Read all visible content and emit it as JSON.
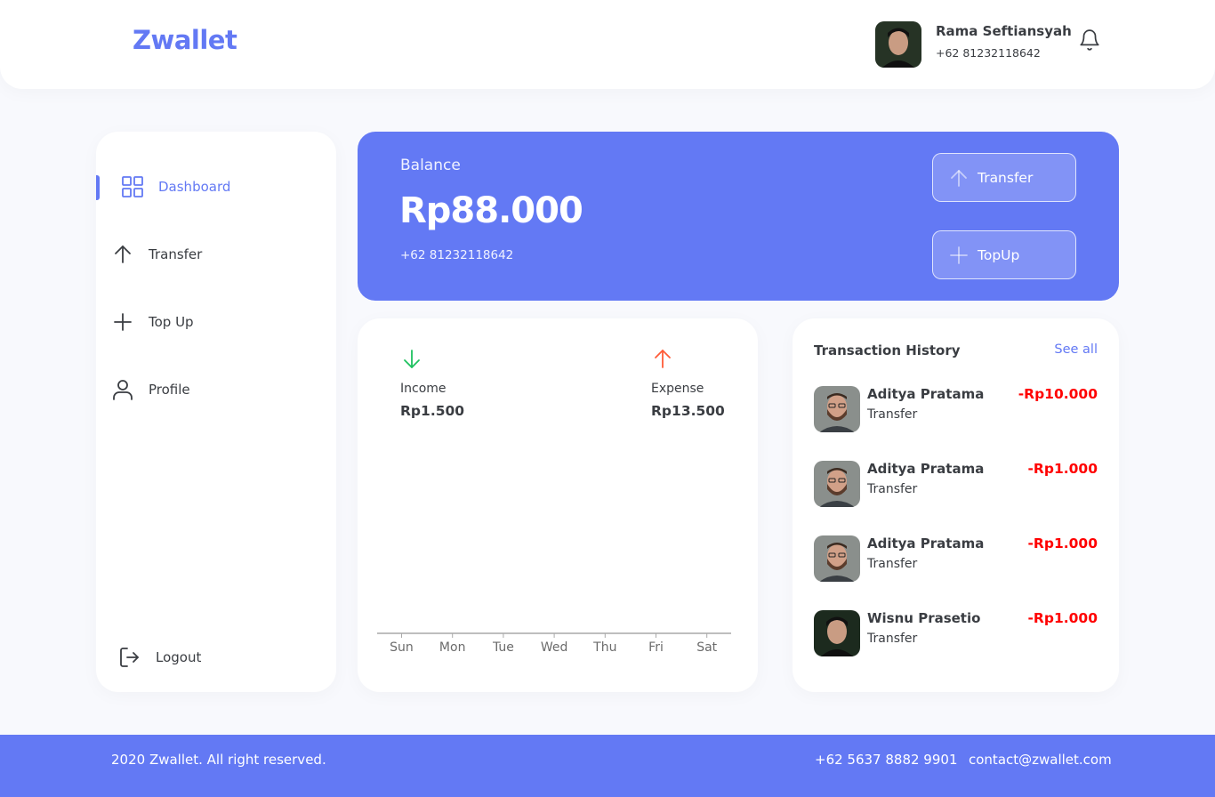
{
  "brand": "Zwallet",
  "user": {
    "name": "Rama Seftiansyah",
    "phone": "+62 81232118642"
  },
  "sidebar": {
    "items": [
      {
        "label": "Dashboard",
        "icon": "grid-icon",
        "active": true
      },
      {
        "label": "Transfer",
        "icon": "arrow-up-icon"
      },
      {
        "label": "Top Up",
        "icon": "plus-icon"
      },
      {
        "label": "Profile",
        "icon": "user-icon"
      }
    ],
    "logout": "Logout"
  },
  "balance": {
    "label": "Balance",
    "value": "Rp88.000",
    "phone": "+62 81232118642",
    "transfer_label": "Transfer",
    "topup_label": "TopUp"
  },
  "stats": {
    "income_label": "Income",
    "income_value": "Rp1.500",
    "expense_label": "Expense",
    "expense_value": "Rp13.500"
  },
  "chart_data": {
    "type": "bar",
    "categories": [
      "Sun",
      "Mon",
      "Tue",
      "Wed",
      "Thu",
      "Fri",
      "Sat"
    ],
    "values": [
      0,
      0,
      0,
      0,
      0,
      0,
      0
    ]
  },
  "history": {
    "title": "Transaction History",
    "see_all": "See all",
    "items": [
      {
        "name": "Aditya Pratama",
        "type": "Transfer",
        "amount": "-Rp10.000"
      },
      {
        "name": "Aditya Pratama",
        "type": "Transfer",
        "amount": "-Rp1.000"
      },
      {
        "name": "Aditya Pratama",
        "type": "Transfer",
        "amount": "-Rp1.000"
      },
      {
        "name": "Wisnu Prasetio",
        "type": "Transfer",
        "amount": "-Rp1.000"
      }
    ]
  },
  "footer": {
    "copyright": "2020 Zwallet. All right reserved.",
    "phone": "+62 5637 8882 9901",
    "email": "contact@zwallet.com"
  },
  "colors": {
    "primary": "#6379f4",
    "income": "#1ec15f",
    "expense": "#ff5b37",
    "negative": "#ff0000"
  }
}
